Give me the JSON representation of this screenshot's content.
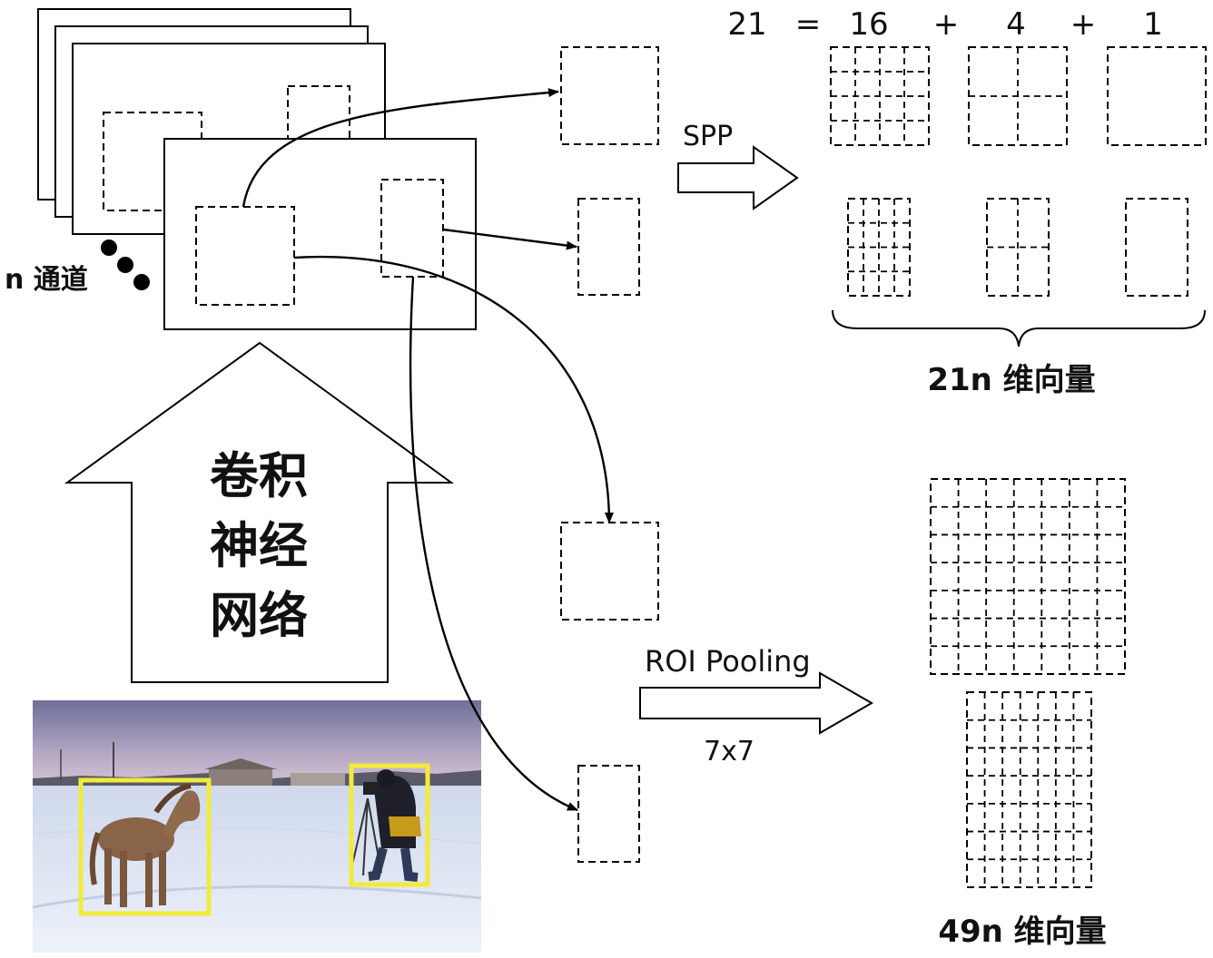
{
  "labels": {
    "channels": "n 通道",
    "spp": "SPP",
    "roi_pooling": "ROI Pooling",
    "roi_size": "7x7",
    "cnn_line1": "卷积",
    "cnn_line2": "神经",
    "cnn_line3": "网络",
    "spp_vector": "21n 维向量",
    "roi_vector": "49n 维向量"
  },
  "equation": {
    "total": "21",
    "eq": "=",
    "a": "16",
    "plus1": "+",
    "b": "4",
    "plus2": "+",
    "c": "1"
  },
  "spp_levels": [
    {
      "grid": 4,
      "label": "16"
    },
    {
      "grid": 2,
      "label": "4"
    },
    {
      "grid": 1,
      "label": "1"
    }
  ],
  "roi_grid": 7,
  "photo": {
    "objects": [
      "horse",
      "person"
    ],
    "box_color": "#f3ea3a",
    "sky_color": "#8f8fb4",
    "snow_color": "#e4ebf6"
  }
}
